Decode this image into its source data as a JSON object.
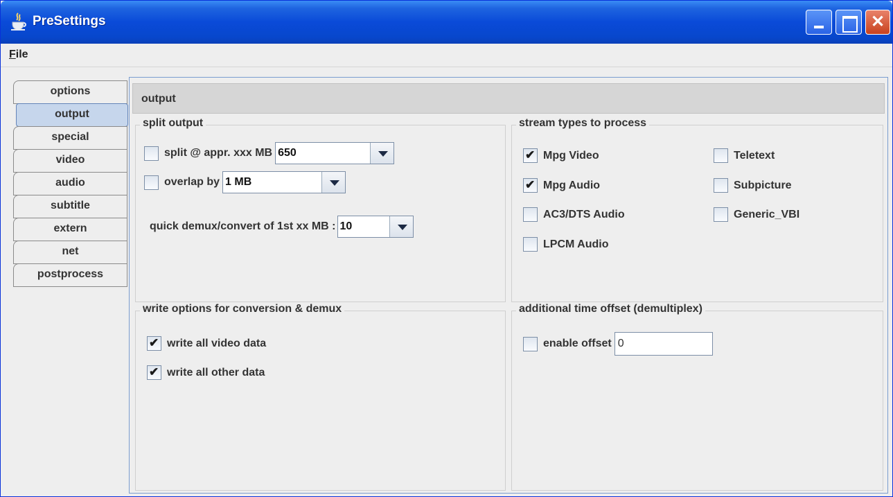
{
  "window": {
    "title": "PreSettings"
  },
  "menu": {
    "file": "File",
    "file_mnemonic": "F",
    "file_rest": "ile"
  },
  "tabs": [
    "options",
    "output",
    "special",
    "video",
    "audio",
    "subtitle",
    "extern",
    "net",
    "postprocess"
  ],
  "selected_tab": "output",
  "panel": {
    "title": "output"
  },
  "split_output": {
    "title": "split output",
    "split_label": "split @ appr. xxx MB",
    "split_checked": false,
    "split_value": "650",
    "overlap_label": "overlap by",
    "overlap_checked": false,
    "overlap_value": "1 MB",
    "quick_label": "quick demux/convert of 1st xx MB :",
    "quick_value": "10"
  },
  "stream_types": {
    "title": "stream types to process",
    "mpg_video": "Mpg Video",
    "mpg_audio": "Mpg Audio",
    "ac3_audio": "AC3/DTS Audio",
    "lpcm_audio": "LPCM Audio",
    "teletext": "Teletext",
    "subpicture": "Subpicture",
    "generic_vbi": "Generic_VBI"
  },
  "write_options": {
    "title": "write options for conversion & demux",
    "video_label": "write all video data",
    "other_label": "write all other data"
  },
  "time_offset": {
    "title": "additional time offset (demultiplex)",
    "enable_label": "enable offset",
    "offset_value": "0"
  }
}
